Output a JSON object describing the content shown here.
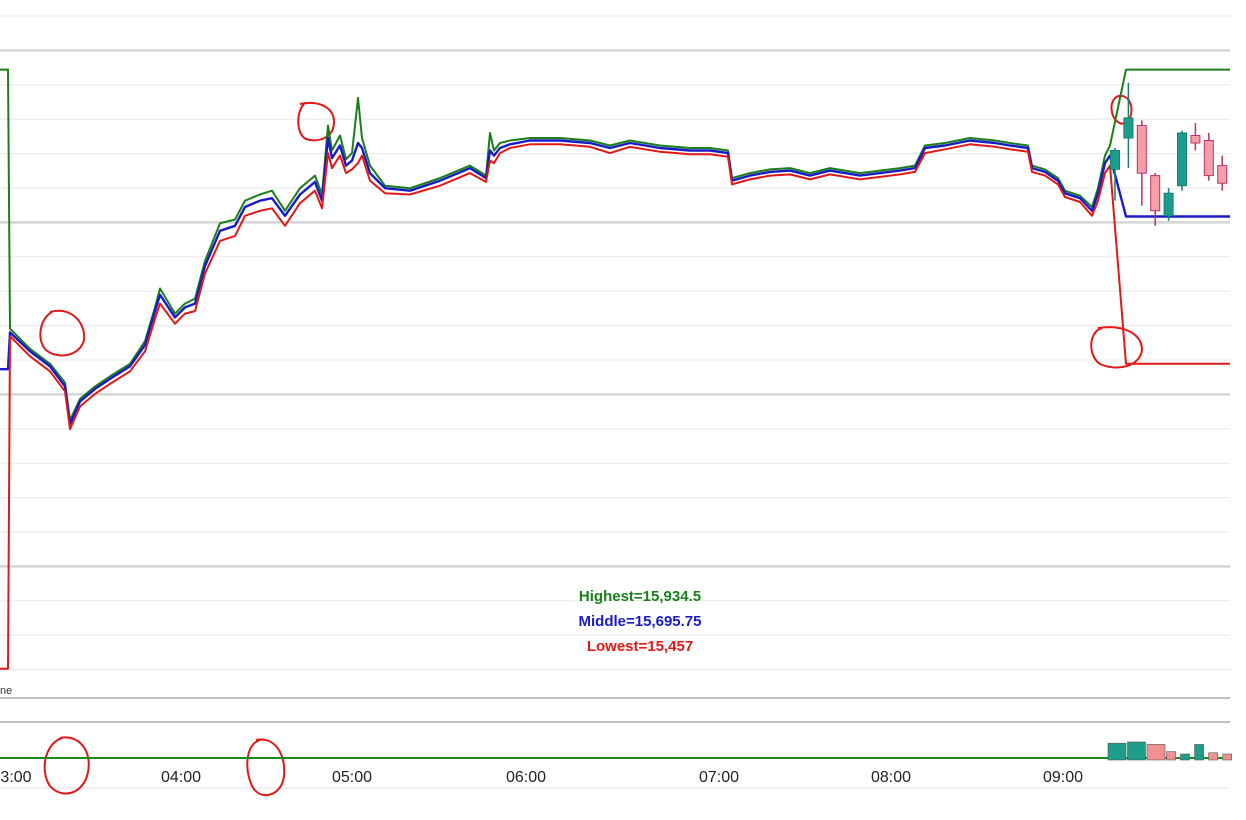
{
  "chart_data": {
    "type": "line",
    "x_ticks": [
      "3:00",
      "04:00",
      "05:00",
      "06:00",
      "07:00",
      "08:00",
      "09:00"
    ],
    "series": [
      {
        "name": "Highest",
        "color": "#1a7f1a",
        "pre_start": 15934.5,
        "after_open": 15934.5,
        "points": [
          [
            0,
            15728
          ],
          [
            20,
            15712
          ],
          [
            40,
            15700
          ],
          [
            55,
            15685
          ],
          [
            60,
            15655
          ],
          [
            70,
            15672
          ],
          [
            85,
            15682
          ],
          [
            100,
            15690
          ],
          [
            120,
            15700
          ],
          [
            135,
            15718
          ],
          [
            145,
            15745
          ],
          [
            150,
            15760
          ],
          [
            165,
            15740
          ],
          [
            175,
            15748
          ],
          [
            185,
            15752
          ],
          [
            195,
            15782
          ],
          [
            210,
            15812
          ],
          [
            225,
            15815
          ],
          [
            235,
            15830
          ],
          [
            250,
            15835
          ],
          [
            262,
            15838
          ],
          [
            275,
            15822
          ],
          [
            290,
            15840
          ],
          [
            305,
            15850
          ],
          [
            312,
            15835
          ],
          [
            318,
            15890
          ],
          [
            322,
            15870
          ],
          [
            330,
            15882
          ],
          [
            336,
            15863
          ],
          [
            342,
            15868
          ],
          [
            348,
            15912
          ],
          [
            352,
            15880
          ],
          [
            360,
            15858
          ],
          [
            375,
            15842
          ],
          [
            400,
            15840
          ],
          [
            430,
            15848
          ],
          [
            460,
            15858
          ],
          [
            476,
            15850
          ],
          [
            480,
            15884
          ],
          [
            484,
            15870
          ],
          [
            490,
            15876
          ],
          [
            500,
            15878
          ],
          [
            520,
            15880
          ],
          [
            550,
            15880
          ],
          [
            580,
            15878
          ],
          [
            600,
            15874
          ],
          [
            620,
            15878
          ],
          [
            650,
            15874
          ],
          [
            680,
            15872
          ],
          [
            700,
            15872
          ],
          [
            718,
            15870
          ],
          [
            722,
            15848
          ],
          [
            740,
            15852
          ],
          [
            760,
            15855
          ],
          [
            780,
            15856
          ],
          [
            800,
            15852
          ],
          [
            820,
            15856
          ],
          [
            850,
            15852
          ],
          [
            870,
            15854
          ],
          [
            890,
            15856
          ],
          [
            905,
            15858
          ],
          [
            915,
            15874
          ],
          [
            935,
            15876
          ],
          [
            960,
            15880
          ],
          [
            985,
            15878
          ],
          [
            1000,
            15876
          ],
          [
            1018,
            15874
          ],
          [
            1022,
            15858
          ],
          [
            1035,
            15855
          ],
          [
            1048,
            15848
          ],
          [
            1055,
            15838
          ],
          [
            1070,
            15834
          ],
          [
            1082,
            15825
          ],
          [
            1088,
            15840
          ],
          [
            1095,
            15866
          ],
          [
            1100,
            15874
          ]
        ]
      },
      {
        "name": "Middle",
        "color": "#1a1ac8",
        "pre_start": 15695.75,
        "after_open": 15817.4,
        "points": [
          [
            0,
            15725
          ],
          [
            20,
            15710
          ],
          [
            40,
            15698
          ],
          [
            55,
            15682
          ],
          [
            60,
            15652
          ],
          [
            70,
            15670
          ],
          [
            85,
            15680
          ],
          [
            100,
            15688
          ],
          [
            120,
            15698
          ],
          [
            135,
            15715
          ],
          [
            145,
            15742
          ],
          [
            150,
            15755
          ],
          [
            165,
            15737
          ],
          [
            175,
            15745
          ],
          [
            185,
            15748
          ],
          [
            195,
            15778
          ],
          [
            210,
            15806
          ],
          [
            225,
            15810
          ],
          [
            235,
            15825
          ],
          [
            250,
            15830
          ],
          [
            262,
            15832
          ],
          [
            275,
            15818
          ],
          [
            290,
            15835
          ],
          [
            305,
            15845
          ],
          [
            312,
            15830
          ],
          [
            318,
            15880
          ],
          [
            322,
            15864
          ],
          [
            330,
            15874
          ],
          [
            336,
            15858
          ],
          [
            342,
            15862
          ],
          [
            348,
            15876
          ],
          [
            352,
            15872
          ],
          [
            360,
            15852
          ],
          [
            375,
            15840
          ],
          [
            400,
            15838
          ],
          [
            430,
            15846
          ],
          [
            460,
            15856
          ],
          [
            476,
            15848
          ],
          [
            480,
            15870
          ],
          [
            484,
            15866
          ],
          [
            490,
            15872
          ],
          [
            500,
            15875
          ],
          [
            520,
            15878
          ],
          [
            550,
            15878
          ],
          [
            580,
            15876
          ],
          [
            600,
            15872
          ],
          [
            620,
            15876
          ],
          [
            650,
            15872
          ],
          [
            680,
            15870
          ],
          [
            700,
            15870
          ],
          [
            718,
            15868
          ],
          [
            722,
            15846
          ],
          [
            740,
            15850
          ],
          [
            760,
            15853
          ],
          [
            780,
            15854
          ],
          [
            800,
            15850
          ],
          [
            820,
            15854
          ],
          [
            850,
            15850
          ],
          [
            870,
            15852
          ],
          [
            890,
            15854
          ],
          [
            905,
            15856
          ],
          [
            915,
            15872
          ],
          [
            935,
            15874
          ],
          [
            960,
            15878
          ],
          [
            985,
            15876
          ],
          [
            1000,
            15874
          ],
          [
            1018,
            15872
          ],
          [
            1022,
            15856
          ],
          [
            1035,
            15853
          ],
          [
            1048,
            15846
          ],
          [
            1055,
            15836
          ],
          [
            1070,
            15832
          ],
          [
            1082,
            15822
          ],
          [
            1088,
            15836
          ],
          [
            1095,
            15860
          ],
          [
            1100,
            15866
          ]
        ]
      },
      {
        "name": "Lowest",
        "color": "#e01818",
        "pre_start": 15457,
        "after_open": 15700,
        "points": [
          [
            0,
            15722
          ],
          [
            20,
            15706
          ],
          [
            40,
            15694
          ],
          [
            55,
            15678
          ],
          [
            60,
            15648
          ],
          [
            70,
            15666
          ],
          [
            85,
            15676
          ],
          [
            100,
            15684
          ],
          [
            120,
            15694
          ],
          [
            135,
            15710
          ],
          [
            145,
            15736
          ],
          [
            150,
            15748
          ],
          [
            165,
            15732
          ],
          [
            175,
            15740
          ],
          [
            185,
            15742
          ],
          [
            195,
            15772
          ],
          [
            210,
            15798
          ],
          [
            225,
            15802
          ],
          [
            235,
            15818
          ],
          [
            250,
            15822
          ],
          [
            262,
            15824
          ],
          [
            275,
            15810
          ],
          [
            290,
            15828
          ],
          [
            305,
            15838
          ],
          [
            312,
            15824
          ],
          [
            318,
            15868
          ],
          [
            322,
            15856
          ],
          [
            330,
            15866
          ],
          [
            336,
            15852
          ],
          [
            342,
            15855
          ],
          [
            348,
            15860
          ],
          [
            352,
            15866
          ],
          [
            360,
            15846
          ],
          [
            375,
            15836
          ],
          [
            400,
            15835
          ],
          [
            430,
            15842
          ],
          [
            460,
            15852
          ],
          [
            476,
            15845
          ],
          [
            480,
            15862
          ],
          [
            484,
            15860
          ],
          [
            490,
            15868
          ],
          [
            500,
            15872
          ],
          [
            520,
            15875
          ],
          [
            550,
            15875
          ],
          [
            580,
            15873
          ],
          [
            600,
            15868
          ],
          [
            620,
            15873
          ],
          [
            650,
            15869
          ],
          [
            680,
            15867
          ],
          [
            700,
            15867
          ],
          [
            718,
            15865
          ],
          [
            722,
            15843
          ],
          [
            740,
            15847
          ],
          [
            760,
            15850
          ],
          [
            780,
            15851
          ],
          [
            800,
            15847
          ],
          [
            820,
            15851
          ],
          [
            850,
            15847
          ],
          [
            870,
            15849
          ],
          [
            890,
            15851
          ],
          [
            905,
            15853
          ],
          [
            915,
            15868
          ],
          [
            935,
            15871
          ],
          [
            960,
            15875
          ],
          [
            985,
            15873
          ],
          [
            1000,
            15871
          ],
          [
            1018,
            15869
          ],
          [
            1022,
            15853
          ],
          [
            1035,
            15850
          ],
          [
            1048,
            15843
          ],
          [
            1055,
            15833
          ],
          [
            1070,
            15829
          ],
          [
            1082,
            15818
          ],
          [
            1088,
            15830
          ],
          [
            1095,
            15852
          ],
          [
            1100,
            15858
          ]
        ]
      }
    ],
    "candles": [
      {
        "open": 15855,
        "close": 15870,
        "high": 15872,
        "low": 15830
      },
      {
        "open": 15880,
        "close": 15896,
        "high": 15924,
        "low": 15856
      },
      {
        "open": 15890,
        "close": 15852,
        "high": 15894,
        "low": 15826
      },
      {
        "open": 15850,
        "close": 15822,
        "high": 15852,
        "low": 15810
      },
      {
        "open": 15818,
        "close": 15836,
        "high": 15840,
        "low": 15814
      },
      {
        "open": 15842,
        "close": 15884,
        "high": 15886,
        "low": 15838
      },
      {
        "open": 15882,
        "close": 15876,
        "high": 15892,
        "low": 15870
      },
      {
        "open": 15878,
        "close": 15850,
        "high": 15884,
        "low": 15846
      },
      {
        "open": 15858,
        "close": 15844,
        "high": 15866,
        "low": 15838
      }
    ],
    "volume": [
      {
        "value": 14,
        "color": "#1e9e8a"
      },
      {
        "value": 15,
        "color": "#1e9e8a"
      },
      {
        "value": 13,
        "color": "#f09090"
      },
      {
        "value": 7,
        "color": "#f09090"
      },
      {
        "value": 5,
        "color": "#1e9e8a"
      },
      {
        "value": 13,
        "color": "#1e9e8a"
      },
      {
        "value": 6,
        "color": "#f09090"
      },
      {
        "value": 5,
        "color": "#f09090"
      },
      {
        "value": 3,
        "color": "#f09090"
      }
    ],
    "ylim": [
      15440,
      15990
    ],
    "volume_max": 15,
    "grid": true,
    "legend_placement": "bottom-center",
    "annotations": "red hand-drawn circles around highs and lows"
  },
  "legend": {
    "highest": "Highest=15,934.5",
    "middle": "Middle=15,695.75",
    "lowest": "Lowest=15,457"
  },
  "pane_label": "ne"
}
